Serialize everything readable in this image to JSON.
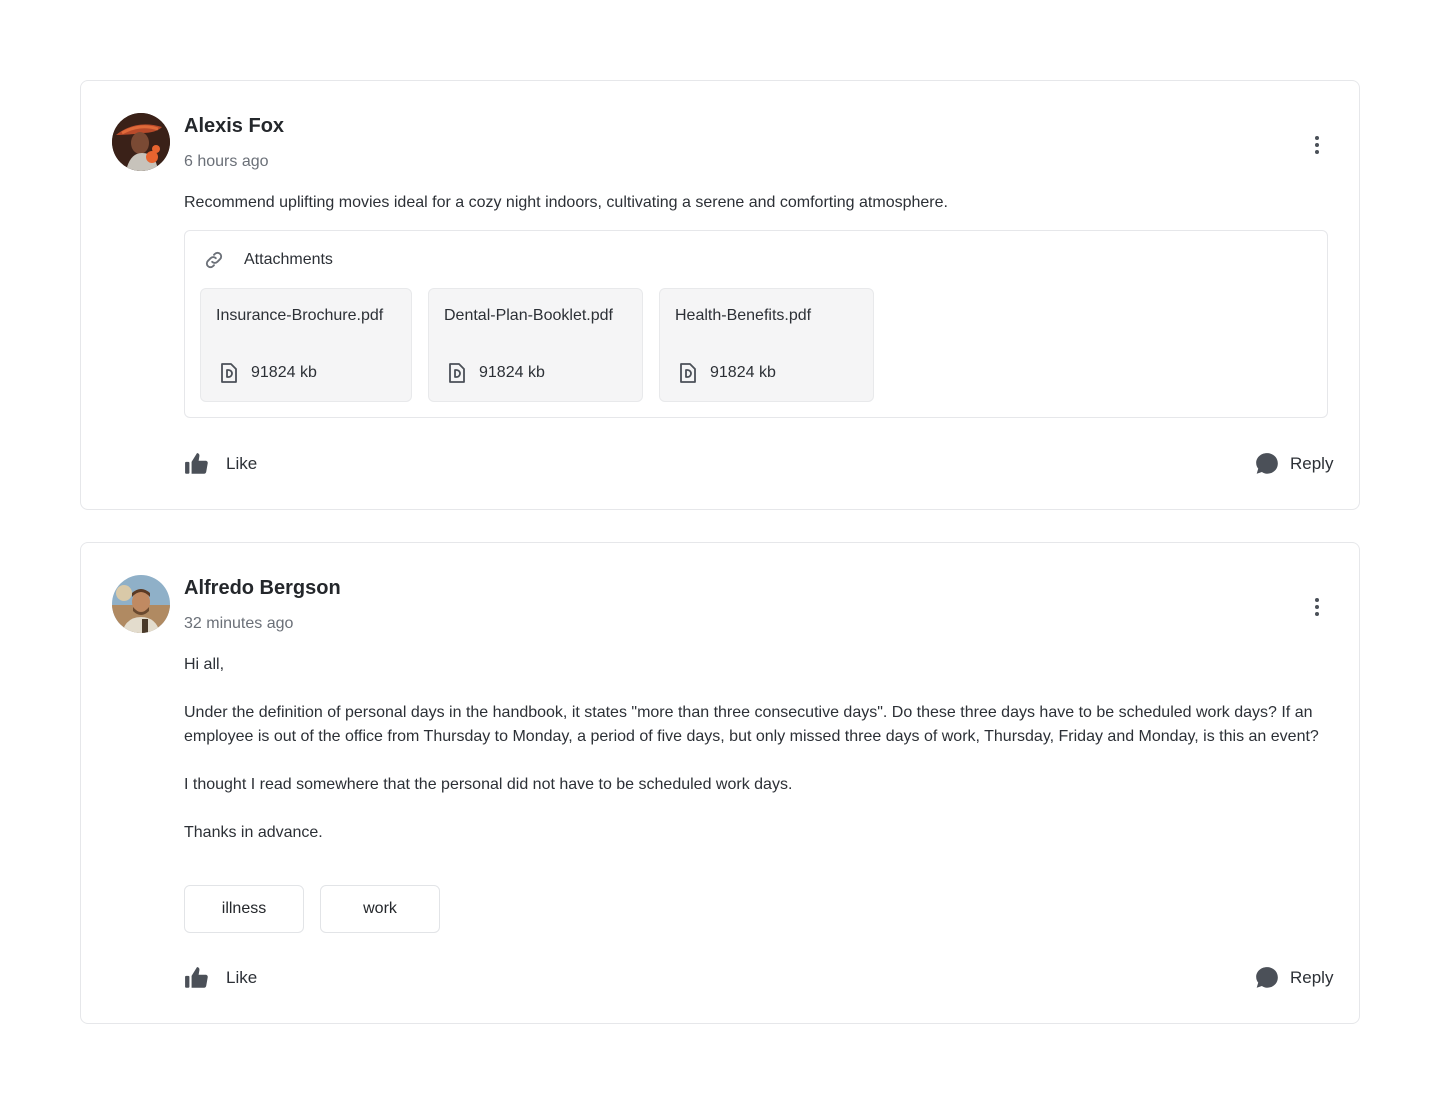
{
  "posts": [
    {
      "author": "Alexis Fox",
      "time": "6 hours ago",
      "body": "Recommend uplifting movies ideal for a cozy night indoors, cultivating a serene and comforting atmosphere.",
      "attachments_label": "Attachments",
      "attachments": [
        {
          "name": "Insurance-Brochure.pdf",
          "size": "91824 kb"
        },
        {
          "name": "Dental-Plan-Booklet.pdf",
          "size": "91824 kb"
        },
        {
          "name": "Health-Benefits.pdf",
          "size": "91824 kb"
        }
      ],
      "like_label": "Like",
      "reply_label": "Reply"
    },
    {
      "author": "Alfredo Bergson",
      "time": "32 minutes ago",
      "paragraphs": [
        "Hi all,",
        "Under the definition of personal days in the handbook, it states \"more than three consecutive days\". Do these three days have to be scheduled work days? If an employee is out of the office from Thursday to Monday, a period of five days, but only missed three days of work, Thursday, Friday and Monday, is this an event?",
        "I thought I read somewhere that the personal did not have to be scheduled work days.",
        "Thanks in advance."
      ],
      "tags": [
        "illness",
        "work"
      ],
      "like_label": "Like",
      "reply_label": "Reply"
    }
  ],
  "icons": {
    "menu": "more-vertical-icon",
    "attachment": "link-icon",
    "file": "pdf-file-icon",
    "like": "thumbs-up-icon",
    "reply": "chat-bubble-icon"
  },
  "colors": {
    "text": "#2c3036",
    "muted": "#6b7078",
    "border": "#e6e7ea",
    "file_bg": "#f5f5f6",
    "icon": "#4b5058"
  }
}
